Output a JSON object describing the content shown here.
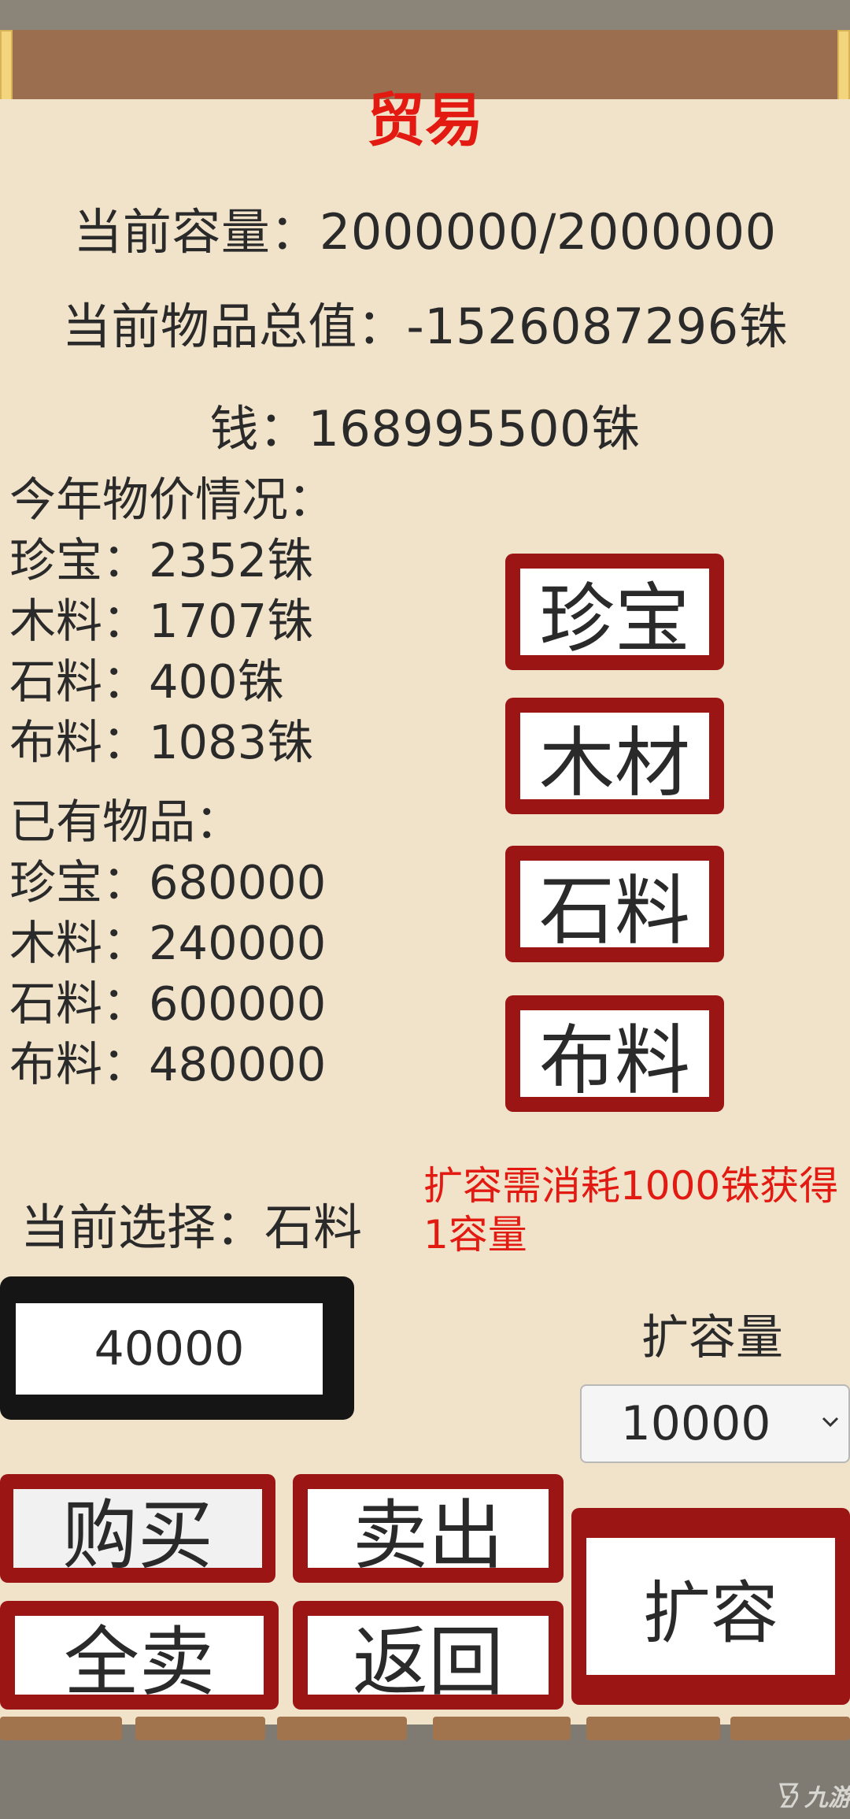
{
  "colors": {
    "accent_red": "#e21a12",
    "button_red": "#9b1515",
    "panel_bg": "#f1e3c9",
    "rod_brown": "#9b6e4f"
  },
  "header": {
    "title": "贸易"
  },
  "stats": {
    "capacity": "当前容量：2000000/2000000",
    "total_value": "当前物品总值：-1526087296铢",
    "money": "钱：168995500铢"
  },
  "prices": {
    "title": "今年物价情况：",
    "items": [
      "珍宝：2352铢",
      "木料：1707铢",
      "石料：400铢",
      "布料：1083铢"
    ]
  },
  "owned": {
    "title": "已有物品：",
    "items": [
      "珍宝：680000",
      "木料：240000",
      "石料：600000",
      "布料：480000"
    ]
  },
  "item_buttons": [
    "珍宝",
    "木材",
    "石料",
    "布料"
  ],
  "selection": {
    "text": "当前选择：石料"
  },
  "expand_note": {
    "line1": "扩容需消耗1000铢获得",
    "line2": "1容量"
  },
  "quantity_input": {
    "value": "40000"
  },
  "expand": {
    "label": "扩容量",
    "select_value": "10000",
    "chevron": "chevron-down-icon",
    "button": "扩容"
  },
  "actions": {
    "buy": "购买",
    "sell": "卖出",
    "sell_all": "全卖",
    "back": "返回"
  },
  "watermark": {
    "text": "九游"
  }
}
